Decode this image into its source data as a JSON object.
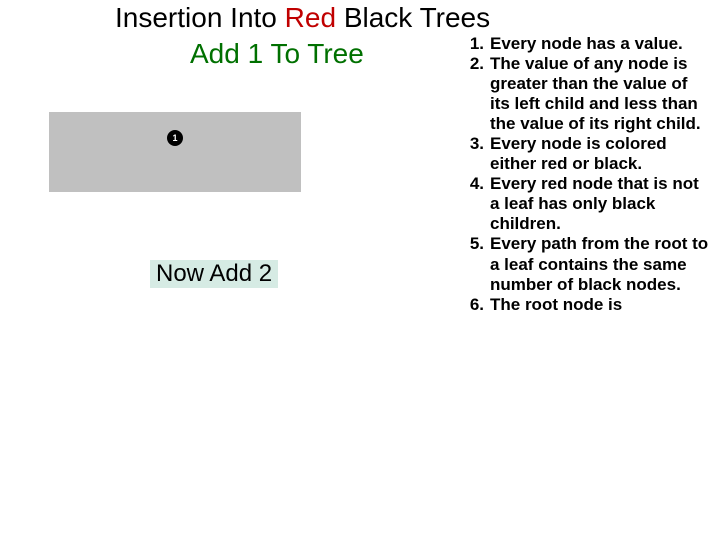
{
  "title": {
    "prefix": "Insertion Into ",
    "red": "Red ",
    "black": "Black ",
    "suffix": "Trees"
  },
  "subtitle": "Add 1 To Tree",
  "tree_node_value": "1",
  "now_label": "Now Add 2",
  "rules": [
    {
      "n": "1.",
      "t": "Every node has a value."
    },
    {
      "n": "2.",
      "t": "The value of any node is greater than the value of its left child and less than the value of its right child."
    },
    {
      "n": "3.",
      "t": "Every node is colored either red or black."
    },
    {
      "n": "4.",
      "t": "Every red node that is not a leaf has only black children."
    },
    {
      "n": "5.",
      "t": "Every path from the root to a leaf contains the same number of black nodes."
    },
    {
      "n": "6.",
      "t": "The root node is"
    }
  ]
}
